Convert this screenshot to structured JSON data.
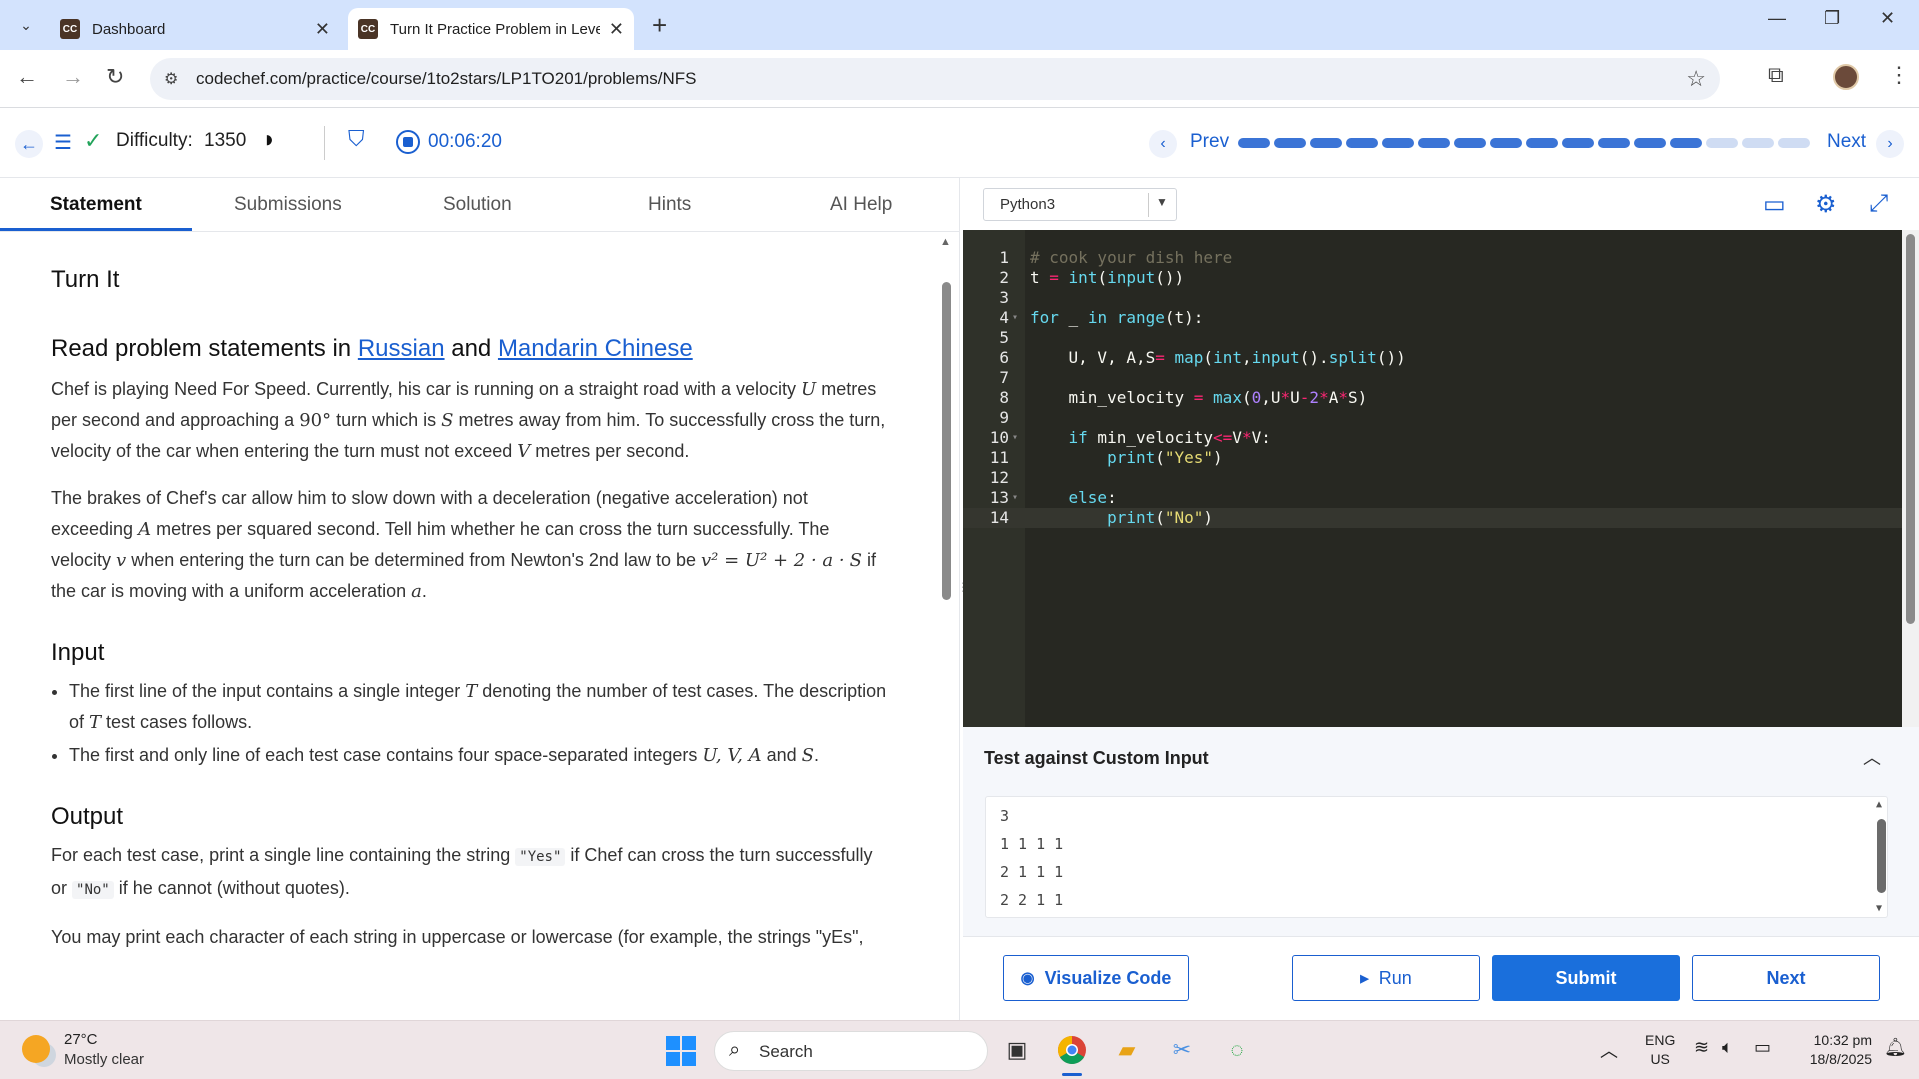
{
  "browser": {
    "tabs": [
      {
        "label": "Dashboard",
        "favicon": "CC",
        "active": false
      },
      {
        "label": "Turn It Practice Problem in Leve",
        "favicon": "CC",
        "active": true
      }
    ],
    "url": "codechef.com/practice/course/1to2stars/LP1TO201/problems/NFS"
  },
  "toolbar": {
    "difficulty_label": "Difficulty:",
    "difficulty_value": "1350",
    "timer": "00:06:20",
    "prev_label": "Prev",
    "next_label": "Next",
    "progress_completed": 13,
    "progress_total": 16,
    "progress_color_done": "#3b74d6",
    "progress_color_todo": "#cfdcf3"
  },
  "problem_tabs": [
    "Statement",
    "Submissions",
    "Solution",
    "Hints",
    "AI Help"
  ],
  "statement": {
    "title": "Turn It",
    "read_prefix": "Read problem statements in ",
    "link_russian": "Russian",
    "read_and": " and ",
    "link_mandarin": "Mandarin Chinese",
    "p1_a": "Chef is playing Need For Speed. Currently, his car is running on a straight road with a velocity ",
    "p1_b": " metres per second and approaching a ",
    "p1_c": " turn which is ",
    "p1_d": " metres away from him. To successfully cross the turn, velocity of the car when entering the turn must not exceed ",
    "p1_e": " metres per second.",
    "p2_a": "The brakes of Chef's car allow him to slow down with a deceleration (negative acceleration) not exceeding ",
    "p2_b": " metres per squared second. Tell him whether he can cross the turn successfully. The velocity ",
    "p2_c": " when entering the turn can be determined from Newton's 2nd law to be ",
    "p2_d": " if the car is moving with a uniform acceleration ",
    "p2_e": ".",
    "input_heading": "Input",
    "input_li1_a": "The first line of the input contains a single integer ",
    "input_li1_b": " denoting the number of test cases. The description of ",
    "input_li1_c": " test cases follows.",
    "input_li2_a": "The first and only line of each test case contains four space-separated integers ",
    "input_li2_b": " and ",
    "input_li2_c": ".",
    "output_heading": "Output",
    "out_p1_a": "For each test case, print a single line containing the string ",
    "out_yes": "\"Yes\"",
    "out_p1_b": " if Chef can cross the turn successfully or ",
    "out_no": "\"No\"",
    "out_p1_c": " if he cannot (without quotes).",
    "out_p2": "You may print each character of each string in uppercase or lowercase (for example, the strings \"yEs\",",
    "math": {
      "U": "U",
      "V": "V",
      "S": "S",
      "A": "A",
      "T": "T",
      "v": "v",
      "a": "a",
      "deg": "90°",
      "formula": "v² = U² + 2 · a ·",
      "formula_S": "S",
      "UVA": "U, V, A"
    }
  },
  "editor": {
    "language": "Python3",
    "lines": [
      "# cook your dish here",
      "t = int(input())",
      "",
      "for _ in range(t):",
      "",
      "    U, V, A,S= map(int,input().split())",
      "",
      "    min_velocity = max(0,U*U-2*A*S)",
      "",
      "    if min_velocity<=V*V:",
      "        print(\"Yes\")",
      "",
      "    else:",
      "        print(\"No\")"
    ]
  },
  "custom_input": {
    "title": "Test against Custom Input",
    "rows": [
      "3",
      "1 1 1 1",
      "2 1 1 1",
      "2 2 1 1"
    ]
  },
  "actions": {
    "visualize": "Visualize Code",
    "run": "Run",
    "submit": "Submit",
    "next": "Next"
  },
  "taskbar": {
    "temp": "27°C",
    "weather": "Mostly clear",
    "search": "Search",
    "lang_top": "ENG",
    "lang_bottom": "US",
    "time": "10:32 pm",
    "date": "18/8/2025"
  }
}
